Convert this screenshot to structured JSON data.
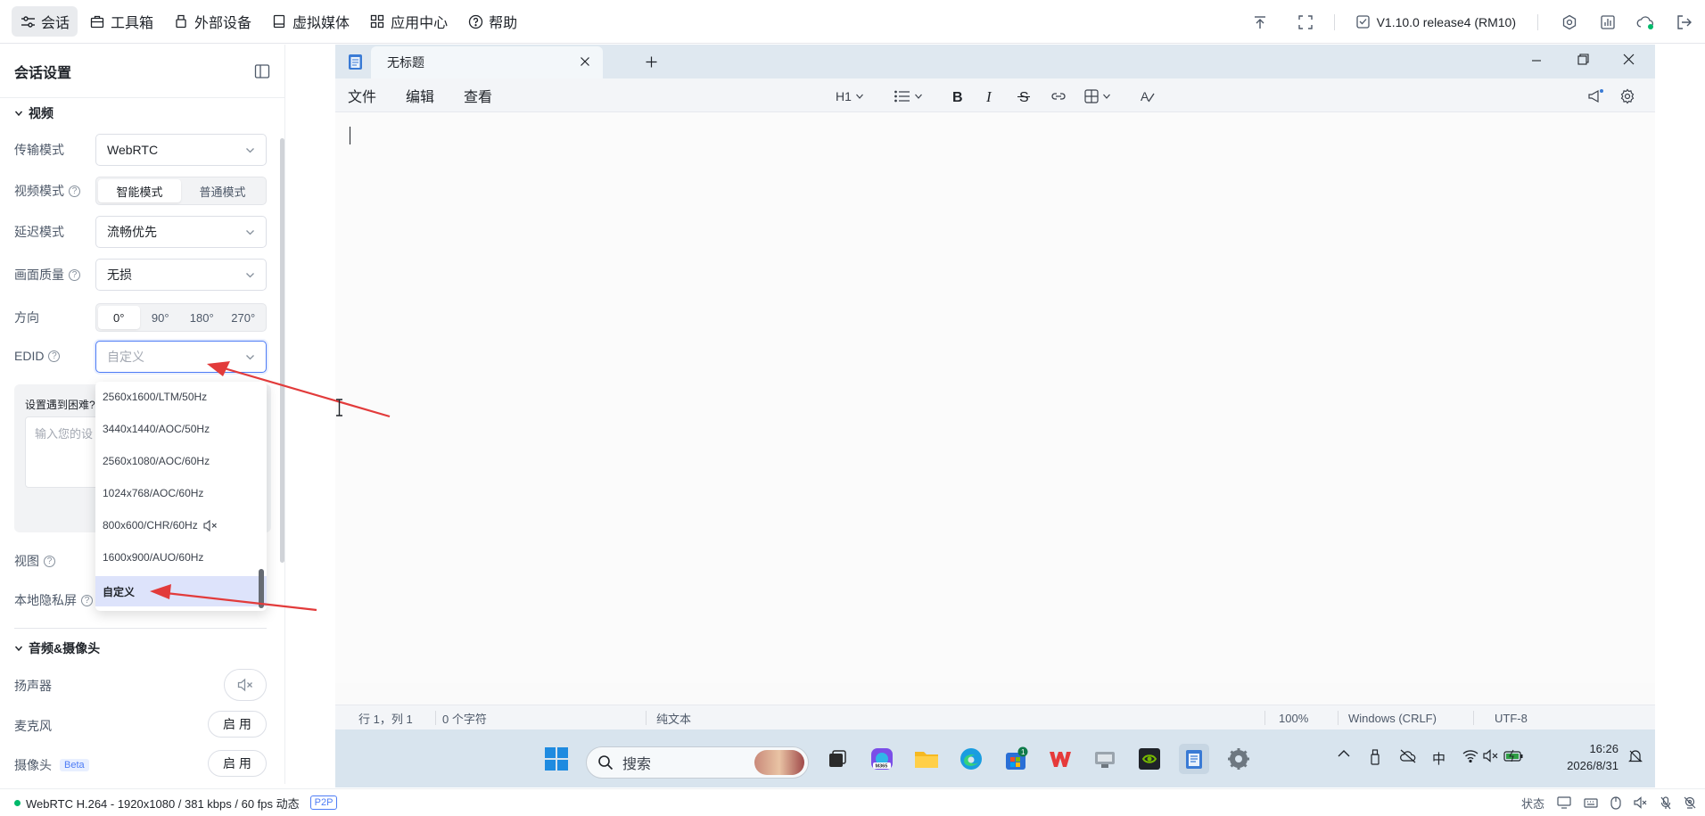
{
  "topbar": {
    "nav": [
      {
        "label": "会话",
        "icon": "sliders-icon"
      },
      {
        "label": "工具箱",
        "icon": "toolbox-icon"
      },
      {
        "label": "外部设备",
        "icon": "usb-icon"
      },
      {
        "label": "虚拟媒体",
        "icon": "media-icon"
      },
      {
        "label": "应用中心",
        "icon": "apps-icon"
      },
      {
        "label": "帮助",
        "icon": "help-icon"
      }
    ],
    "version": "V1.10.0 release4 (RM10)"
  },
  "sidebar": {
    "title": "会话设置",
    "video_section": "视频",
    "transport_label": "传输模式",
    "transport_value": "WebRTC",
    "video_mode_label": "视频模式",
    "video_mode_options": [
      "智能模式",
      "普通模式"
    ],
    "latency_label": "延迟模式",
    "latency_value": "流畅优先",
    "quality_label": "画面质量",
    "quality_value": "无损",
    "direction_label": "方向",
    "direction_options": [
      "0°",
      "90°",
      "180°",
      "270°"
    ],
    "edid_label": "EDID",
    "edid_placeholder": "自定义",
    "feedback_title": "设置遇到困难?",
    "feedback_placeholder": "输入您的设",
    "view_label": "视图",
    "privacy_label": "本地隐私屏",
    "audio_section": "音频&摄像头",
    "speaker_label": "扬声器",
    "mic_label": "麦克风",
    "mic_button": "启 用",
    "camera_label": "摄像头",
    "camera_badge": "Beta",
    "camera_button": "启 用"
  },
  "edid_dropdown": {
    "items": [
      "2560x1600/LTM/50Hz",
      "3440x1440/AOC/50Hz",
      "2560x1080/AOC/60Hz",
      "1024x768/AOC/60Hz",
      "800x600/CHR/60Hz",
      "1600x900/AUO/60Hz",
      "自定义"
    ],
    "selected": "自定义"
  },
  "notepad": {
    "tab_title": "无标题",
    "menus": [
      "文件",
      "编辑",
      "查看"
    ],
    "heading": "H1",
    "status": {
      "position": "行 1，列 1",
      "chars": "0 个字符",
      "format": "纯文本",
      "zoom": "100%",
      "line_ending": "Windows (CRLF)",
      "encoding": "UTF-8"
    }
  },
  "taskbar": {
    "search_placeholder": "搜索",
    "store_badge": "1",
    "ime": "中",
    "time": "16:26",
    "date": "2026/8/31"
  },
  "bottom": {
    "stream_info": "WebRTC H.264 - 1920x1080 / 381 kbps / 60 fps 动态",
    "p2p": "P2P",
    "status_label": "状态"
  }
}
